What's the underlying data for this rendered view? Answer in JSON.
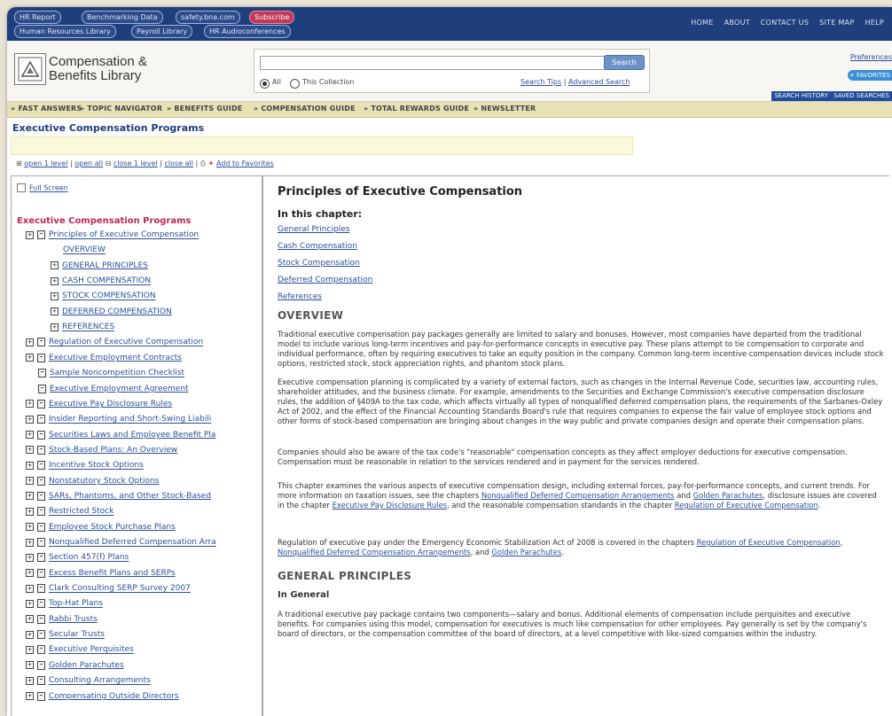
{
  "top_nav": {
    "pills": [
      "HR Report",
      "Benchmarking Data",
      "safety.bna.com",
      "Subscribe"
    ],
    "pills2": [
      "Human Resources Library",
      "Payroll Library",
      "HR Audioconferences"
    ],
    "links": [
      "HOME",
      "ABOUT",
      "CONTACT US",
      "SITE MAP",
      "HELP"
    ]
  },
  "header": {
    "logo_line1": "Compensation &",
    "logo_line2": "Benefits Library",
    "search_placeholder": "",
    "search_button": "Search",
    "radio_all": "All",
    "radio_collection": "This Collection",
    "search_tips": "Search Tips",
    "advanced_search": "Advanced Search",
    "preferences": "Preferences",
    "favorites": "+ FAVORITES",
    "search_history": "SEARCH HISTORY",
    "saved_searches": "SAVED SEARCHES"
  },
  "nav": [
    "» FAST ANSWERS",
    "» TOPIC NAVIGATOR",
    "» BENEFITS GUIDE",
    "» COMPENSATION GUIDE",
    "» TOTAL REWARDS GUIDE",
    "» NEWSLETTER"
  ],
  "page_title": "Executive Compensation Programs",
  "toolbar": {
    "open1": "open 1 level",
    "openall": "open all",
    "close1": "close 1 level",
    "closeall": "close all",
    "addfav": "Add to Favorites"
  },
  "left": {
    "full_screen": "Full Screen",
    "tree_title": "Executive Compensation Programs",
    "items": [
      {
        "label": "Principles of Executive Compensation",
        "icon": "plus-book"
      },
      {
        "label": "OVERVIEW",
        "icon": "none"
      },
      {
        "label": "GENERAL PRINCIPLES",
        "icon": "plus"
      },
      {
        "label": "CASH COMPENSATION",
        "icon": "plus"
      },
      {
        "label": "STOCK COMPENSATION",
        "icon": "plus"
      },
      {
        "label": "DEFERRED COMPENSATION",
        "icon": "plus"
      },
      {
        "label": "REFERENCES",
        "icon": "plus"
      },
      {
        "label": "Regulation of Executive Compensation",
        "icon": "plus-book"
      },
      {
        "label": "Executive Employment Contracts",
        "icon": "plus-book"
      },
      {
        "label": "Sample Noncompetition Checklist",
        "icon": "book"
      },
      {
        "label": "Executive Employment Agreement",
        "icon": "book"
      },
      {
        "label": "Executive Pay Disclosure Rules",
        "icon": "plus-book"
      },
      {
        "label": "Insider Reporting and Short-Swing Liabili",
        "icon": "plus-book"
      },
      {
        "label": "Securities Laws and Employee Benefit Pla",
        "icon": "plus-book"
      },
      {
        "label": "Stock-Based Plans: An Overview",
        "icon": "plus-book"
      },
      {
        "label": "Incentive Stock Options",
        "icon": "plus-book"
      },
      {
        "label": "Nonstatutory Stock Options",
        "icon": "plus-book"
      },
      {
        "label": "SARs, Phantoms, and Other Stock-Based",
        "icon": "plus-book"
      },
      {
        "label": "Restricted Stock",
        "icon": "plus-book"
      },
      {
        "label": "Employee Stock Purchase Plans",
        "icon": "plus-book"
      },
      {
        "label": "Nonqualified Deferred Compensation Arra",
        "icon": "plus-book"
      },
      {
        "label": "Section 457(f) Plans",
        "icon": "plus-book"
      },
      {
        "label": "Excess Benefit Plans and SERPs",
        "icon": "plus-book"
      },
      {
        "label": "Clark Consulting SERP Survey 2007",
        "icon": "plus-book"
      },
      {
        "label": "Top-Hat Plans",
        "icon": "plus-book"
      },
      {
        "label": "Rabbi Trusts",
        "icon": "plus-book"
      },
      {
        "label": "Secular Trusts",
        "icon": "plus-book"
      },
      {
        "label": "Executive Perquisites",
        "icon": "plus-book"
      },
      {
        "label": "Golden Parachutes",
        "icon": "plus-book"
      },
      {
        "label": "Consulting Arrangements",
        "icon": "plus-book"
      },
      {
        "label": "Compensating Outside Directors",
        "icon": "plus-book"
      }
    ]
  },
  "content": {
    "title": "Principles of Executive Compensation",
    "in_chapter": "In this chapter:",
    "chapter_links": [
      "General Principles",
      "Cash Compensation",
      "Stock Compensation",
      "Deferred Compensation",
      "References"
    ],
    "overview_heading": "OVERVIEW",
    "p1": "Traditional executive compensation pay packages generally are limited to salary and bonuses. However, most companies have departed from the traditional model to include various long-term incentives and pay-for-performance concepts in executive pay. These plans attempt to tie compensation to corporate and individual performance, often by requiring executives to take an equity position in the company. Common long-term incentive compensation devices include stock options, restricted stock, stock appreciation rights, and phantom stock plans.",
    "p2": "Executive compensation planning is complicated by a variety of external factors, such as changes in the Internal Revenue Code, securities law, accounting rules, shareholder attitudes, and the business climate. For example, amendments to the Securities and Exchange Commission's executive compensation disclosure rules, the addition of §409A to the tax code, which affects virtually all types of nonqualified deferred compensation plans, the requirements of the Sarbanes-Oxley Act of 2002, and the effect of the Financial Accounting Standards Board's rule that requires companies to expense the fair value of employee stock options and other forms of stock-based compensation are bringing about changes in the way public and private companies design and operate their compensation plans.",
    "p3": "Companies should also be aware of the tax code's \"reasonable\" compensation concepts as they affect employer deductions for executive compensation. Compensation must be reasonable in relation to the services rendered and in payment for the services rendered.",
    "p4_a": "This chapter examines the various aspects of executive compensation design, including external forces, pay-for-performance concepts, and current trends. For more information on taxation issues, see the chapters ",
    "p4_l1": "Nonqualified Deferred Compensation Arrangements",
    "p4_b": " and ",
    "p4_l2": "Golden Parachutes",
    "p4_c": ", disclosure issues are covered in the chapter ",
    "p4_l3": "Executive Pay Disclosure Rules",
    "p4_d": ", and the reasonable compensation standards in the chapter ",
    "p4_l4": "Regulation of Executive Compensation",
    "p4_e": ".",
    "p5_a": "Regulation of executive pay under the Emergency Economic Stabilization Act of 2008 is covered in the chapters ",
    "p5_l1": "Regulation of Executive Compensation",
    "p5_b": ", ",
    "p5_l2": "Nonqualified Deferred Compensation Arrangements",
    "p5_c": ", and ",
    "p5_l3": "Golden Parachutes",
    "p5_d": ".",
    "gp_heading": "GENERAL PRINCIPLES",
    "in_general": "In General",
    "p6": "A traditional executive pay package contains two components—salary and bonus. Additional elements of compensation include perquisites and executive benefits. For companies using this model, compensation for executives is much like compensation for other employees. Pay generally is set by the company's board of directors, or the compensation committee of the board of directors, at a level competitive with like-sized companies within the industry."
  },
  "colors": {
    "topbar": "#1f3e7c",
    "nav_bg": "#e7e1b6",
    "link": "#2a4f9a",
    "tree_title": "#c0275a"
  }
}
